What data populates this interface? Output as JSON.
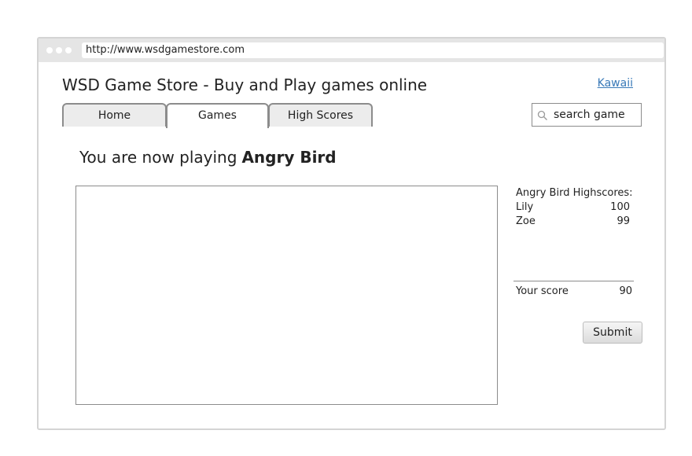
{
  "browser": {
    "url": "http://www.wsdgamestore.com"
  },
  "header": {
    "site_title": "WSD Game Store - Buy and Play games online",
    "user_link": "Kawaii"
  },
  "nav": {
    "tabs": [
      {
        "label": "Home",
        "active": false
      },
      {
        "label": "Games",
        "active": true
      },
      {
        "label": "High Scores",
        "active": false
      }
    ]
  },
  "search": {
    "placeholder": "search game",
    "icon": "search-icon"
  },
  "main": {
    "now_playing_prefix": "You are now playing",
    "game_name": "Angry Bird"
  },
  "highscores": {
    "title": "Angry Bird Highscores:",
    "entries": [
      {
        "name": "Lily",
        "score": "100"
      },
      {
        "name": "Zoe",
        "score": "99"
      }
    ]
  },
  "your_score": {
    "label": "Your score",
    "value": "90"
  },
  "actions": {
    "submit_label": "Submit"
  },
  "colors": {
    "window_border": "#d4d4d4",
    "browser_bar": "#e5e5e5",
    "tab_border": "#8c8c8c",
    "link": "#3a7ab8"
  }
}
